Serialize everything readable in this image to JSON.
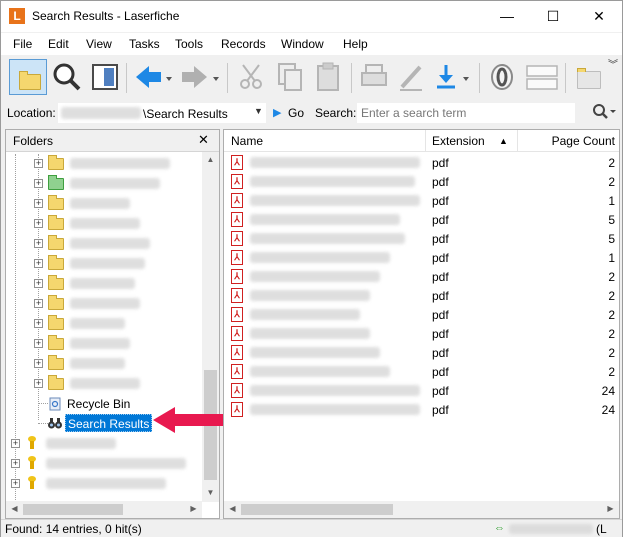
{
  "window": {
    "title": "Search Results - Laserfiche",
    "app_logo": "L",
    "minimize": "—",
    "maximize": "☐",
    "close": "✕"
  },
  "menu": [
    "File",
    "Edit",
    "View",
    "Tasks",
    "Tools",
    "Records",
    "Window",
    "Help"
  ],
  "toolbar": {
    "icons": [
      "folder-icon",
      "search-icon",
      "document-viewer-icon",
      "back-arrow-icon",
      "forward-arrow-icon",
      "cut-icon",
      "copy-icon",
      "paste-icon",
      "print-icon",
      "annotate-icon",
      "download-icon",
      "ocr-icon",
      "metadata-icon",
      "new-folder-icon",
      "more-icon"
    ]
  },
  "locationbar": {
    "location_label": "Location:",
    "location_value": "\\Search Results",
    "go_label": "Go",
    "search_label": "Search:",
    "search_placeholder": "Enter a search term"
  },
  "folders": {
    "title": "Folders",
    "close": "✕",
    "recycle_bin": "Recycle Bin",
    "search_results": "Search Results"
  },
  "results": {
    "columns": {
      "name": "Name",
      "extension": "Extension",
      "page_count": "Page Count"
    },
    "rows": [
      {
        "ext": "pdf",
        "pages": "2"
      },
      {
        "ext": "pdf",
        "pages": "2"
      },
      {
        "ext": "pdf",
        "pages": "1"
      },
      {
        "ext": "pdf",
        "pages": "5"
      },
      {
        "ext": "pdf",
        "pages": "5"
      },
      {
        "ext": "pdf",
        "pages": "1"
      },
      {
        "ext": "pdf",
        "pages": "2"
      },
      {
        "ext": "pdf",
        "pages": "2"
      },
      {
        "ext": "pdf",
        "pages": "2"
      },
      {
        "ext": "pdf",
        "pages": "2"
      },
      {
        "ext": "pdf",
        "pages": "2"
      },
      {
        "ext": "pdf",
        "pages": "2"
      },
      {
        "ext": "pdf",
        "pages": "24"
      },
      {
        "ext": "pdf",
        "pages": "24"
      }
    ]
  },
  "statusbar": {
    "text": "Found: 14 entries, 0 hit(s)",
    "right_text": "(L"
  },
  "colors": {
    "selection": "#0078d7",
    "callout": "#e8194f",
    "accent_blue": "#1e88e5"
  }
}
